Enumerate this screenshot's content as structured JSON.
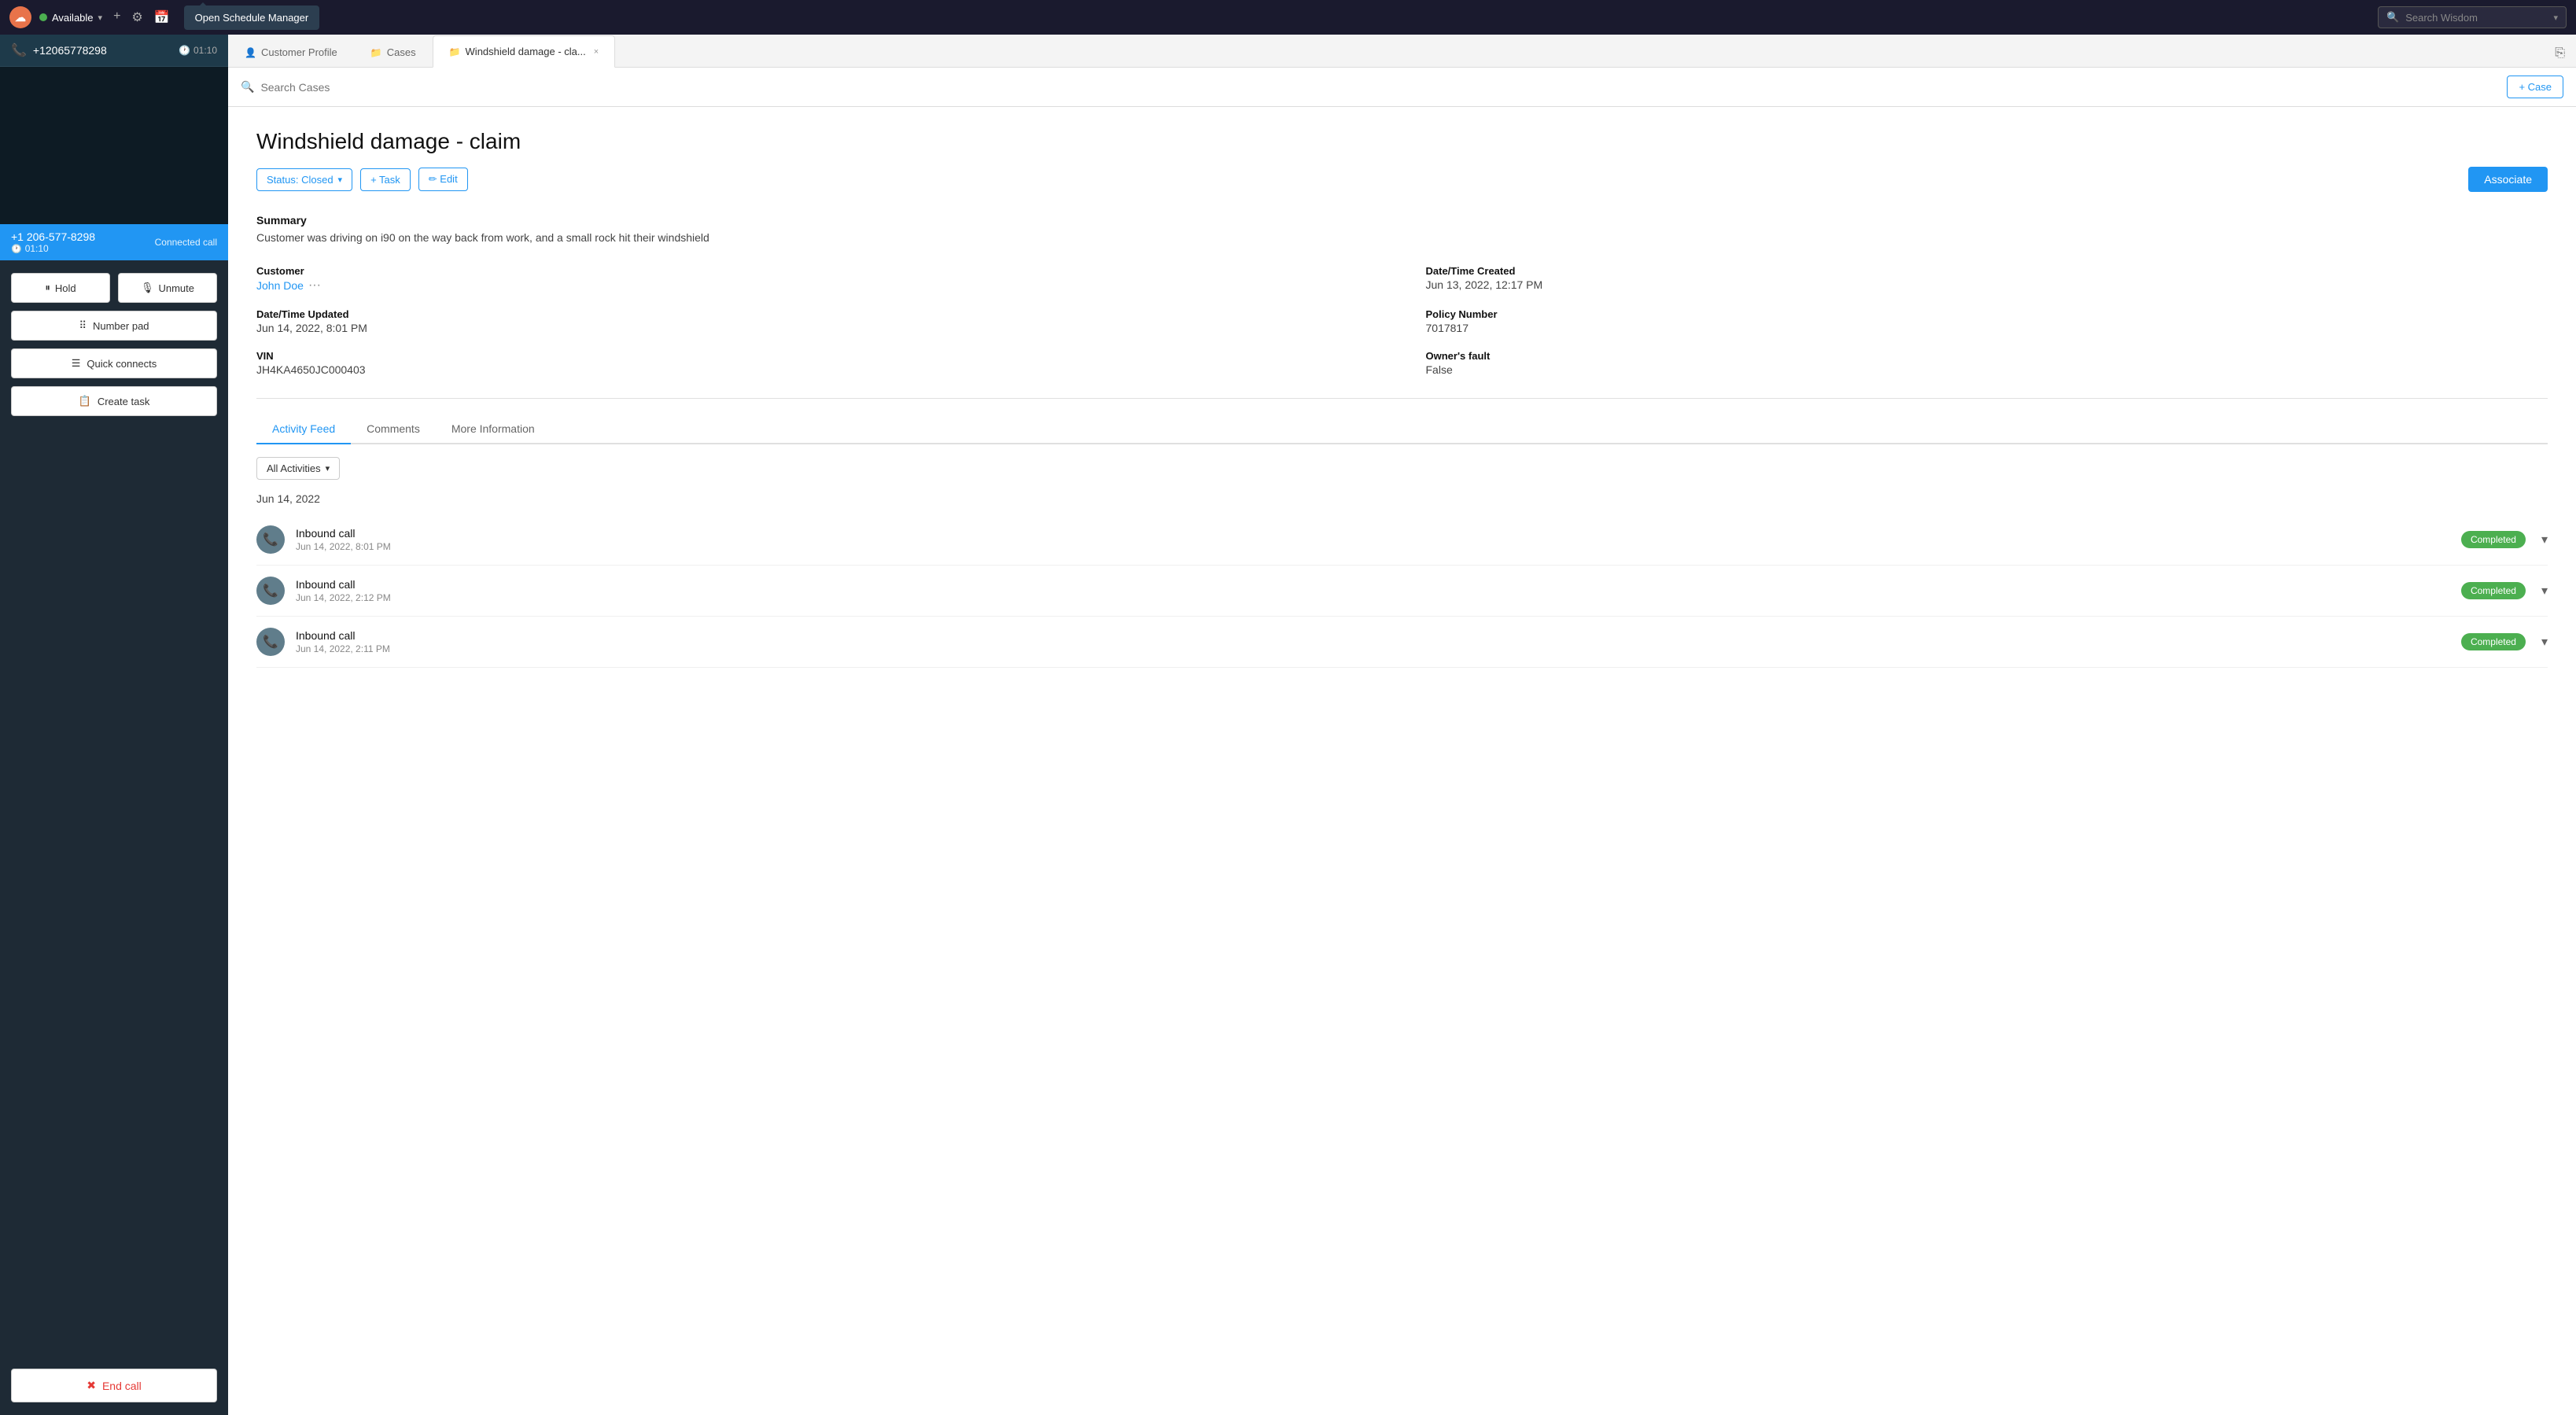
{
  "topbar": {
    "logo": "☁",
    "availability": "Available",
    "availability_chevron": "▾",
    "plus_icon": "+",
    "gear_icon": "⚙",
    "calendar_icon": "📅",
    "schedule_tooltip": "Open Schedule Manager",
    "wisdom_search_placeholder": "Search Wisdom",
    "wisdom_chevron": "▾",
    "share_icon": "⎘"
  },
  "sidebar": {
    "call_number": "+12065778298",
    "call_timer": "01:10",
    "clock_icon": "🕐",
    "phone_icon": "📞",
    "connected_status": "+1 206-577-8298",
    "connected_timer": "01:10",
    "connected_label": "Connected call",
    "hold_label": "Hold",
    "unmute_label": "Unmute",
    "numpad_label": "Number pad",
    "quickconnects_label": "Quick connects",
    "createtask_label": "Create task",
    "endcall_label": "End call"
  },
  "tabs": {
    "customer_tab": "Customer Profile",
    "cases_tab": "Cases",
    "windshield_tab": "Windshield damage - cla...",
    "windshield_tab_close": "×"
  },
  "search": {
    "cases_placeholder": "Search Cases",
    "add_case_label": "+ Case"
  },
  "case": {
    "title": "Windshield damage - claim",
    "status_label": "Status: Closed",
    "task_label": "+ Task",
    "edit_label": "✏ Edit",
    "associate_label": "Associate",
    "summary_label": "Summary",
    "summary_text": "Customer was driving on i90 on the way back from work, and a small rock hit their windshield",
    "customer_label": "Customer",
    "customer_value": "John Doe",
    "customer_dots": "···",
    "date_created_label": "Date/Time Created",
    "date_created_value": "Jun 13, 2022, 12:17 PM",
    "date_updated_label": "Date/Time Updated",
    "date_updated_value": "Jun 14, 2022, 8:01 PM",
    "policy_label": "Policy Number",
    "policy_value": "7017817",
    "vin_label": "VIN",
    "vin_value": "JH4KA4650JC000403",
    "owners_fault_label": "Owner's fault",
    "owners_fault_value": "False"
  },
  "inner_tabs": {
    "activity_feed": "Activity Feed",
    "comments": "Comments",
    "more_information": "More Information"
  },
  "activities": {
    "filter_label": "All Activities",
    "date_group": "Jun 14, 2022",
    "items": [
      {
        "title": "Inbound call",
        "time": "Jun 14, 2022, 8:01 PM",
        "status": "Completed"
      },
      {
        "title": "Inbound call",
        "time": "Jun 14, 2022, 2:12 PM",
        "status": "Completed"
      },
      {
        "title": "Inbound call",
        "time": "Jun 14, 2022, 2:11 PM",
        "status": "Completed"
      }
    ]
  }
}
